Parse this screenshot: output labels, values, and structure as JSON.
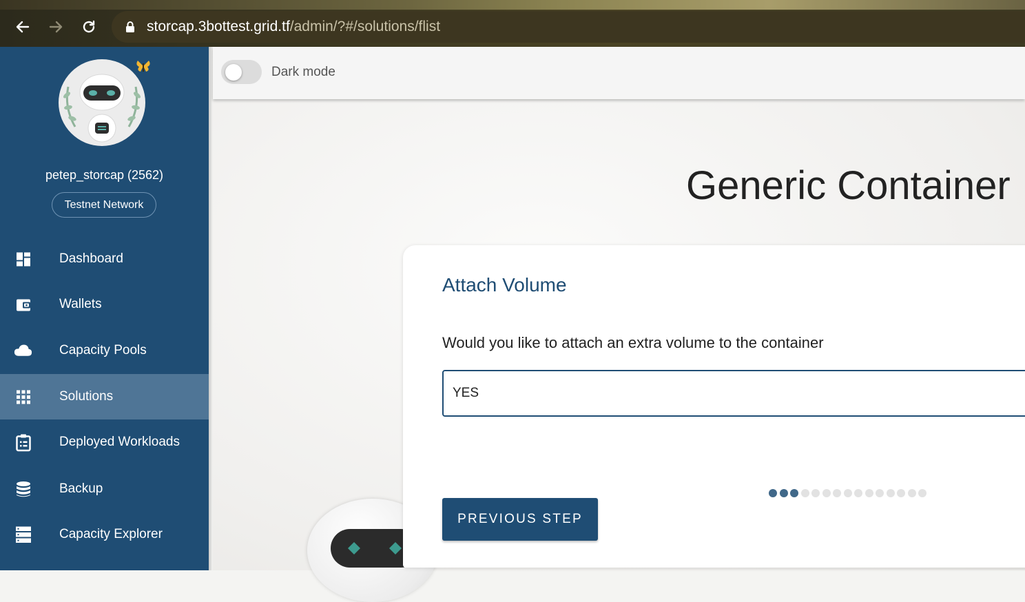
{
  "browser": {
    "url_host": "storcap.3bottest.grid.tf",
    "url_path": "/admin/?#/solutions/flist"
  },
  "topbar": {
    "dark_mode_label": "Dark mode",
    "dark_mode_on": false
  },
  "sidebar": {
    "username": "petep_storcap (2562)",
    "network": "Testnet Network",
    "items": [
      {
        "label": "Dashboard",
        "icon": "dashboard-icon",
        "active": false
      },
      {
        "label": "Wallets",
        "icon": "wallet-icon",
        "active": false
      },
      {
        "label": "Capacity Pools",
        "icon": "cloud-icon",
        "active": false
      },
      {
        "label": "Solutions",
        "icon": "apps-grid-icon",
        "active": true
      },
      {
        "label": "Deployed Workloads",
        "icon": "clipboard-list-icon",
        "active": false
      },
      {
        "label": "Backup",
        "icon": "database-icon",
        "active": false
      },
      {
        "label": "Capacity Explorer",
        "icon": "storage-icon",
        "active": false
      }
    ]
  },
  "main": {
    "page_title": "Generic Container",
    "card": {
      "title": "Attach Volume",
      "question": "Would you like to attach an extra volume to the container",
      "field_value": "YES",
      "prev_button": "PREVIOUS STEP",
      "step_current": 3,
      "step_total": 15
    }
  },
  "colors": {
    "sidebar": "#1f4d74",
    "sidebar_active": "#4f7596",
    "primary": "#1f4d74"
  }
}
